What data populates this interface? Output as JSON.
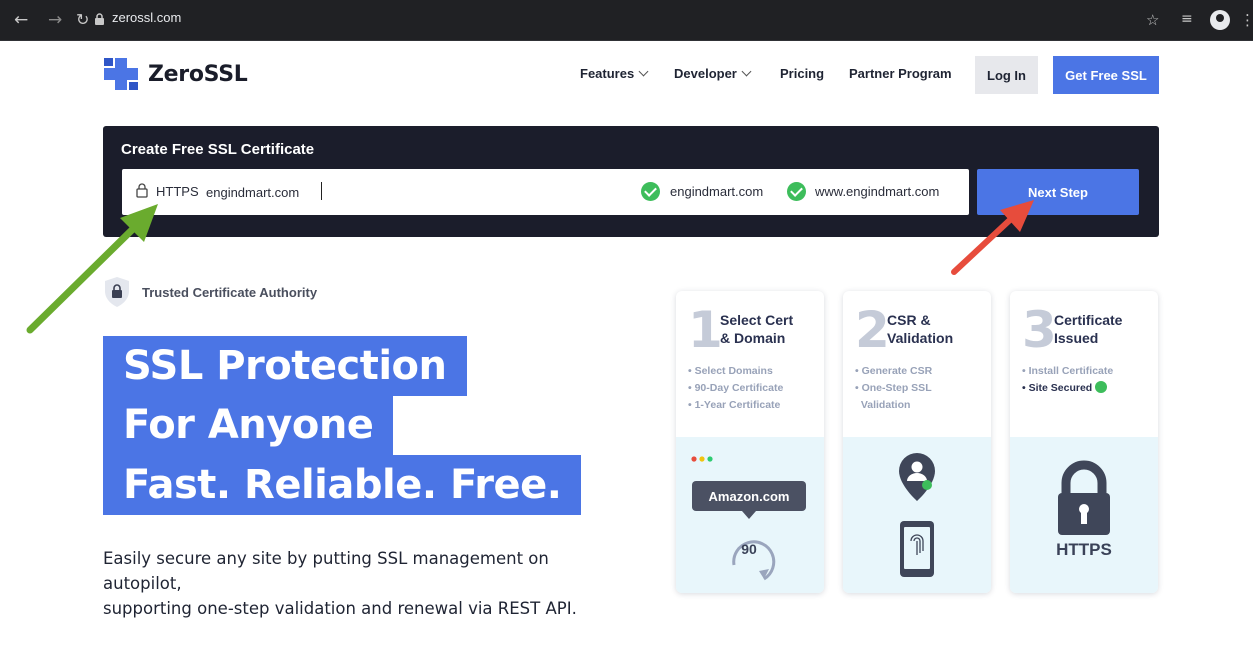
{
  "browser": {
    "url": "zerossl.com"
  },
  "header": {
    "logo_text": "ZeroSSL",
    "nav": {
      "features": "Features",
      "developer": "Developer",
      "pricing": "Pricing",
      "partner": "Partner Program"
    },
    "login_label": "Log In",
    "get_free_label": "Get Free SSL"
  },
  "create": {
    "title": "Create Free SSL Certificate",
    "protocol": "HTTPS",
    "domain_value": "engindmart.com",
    "variants": [
      "engindmart.com",
      "www.engindmart.com"
    ],
    "next_label": "Next Step"
  },
  "trusted": {
    "label": "Trusted Certificate Authority"
  },
  "hero": {
    "lines": [
      "SSL Protection",
      "For Anyone",
      "Fast. Reliable. Free."
    ],
    "description_1": "Easily secure any site by putting SSL management on autopilot,",
    "description_2": "supporting one-step validation and renewal via REST API."
  },
  "steps": [
    {
      "number": "1",
      "title_1": "Select Cert",
      "title_2": "& Domain",
      "bullets": [
        "• Select Domains",
        "• 90-Day Certificate",
        "• 1-Year Certificate"
      ],
      "illustration_label": "Amazon.com",
      "illustration_number": "90"
    },
    {
      "number": "2",
      "title_1": "CSR &",
      "title_2": "Validation",
      "bullets": [
        "• Generate CSR",
        "• One-Step SSL",
        "  Validation"
      ]
    },
    {
      "number": "3",
      "title_1": "Certificate",
      "title_2": "Issued",
      "bullets": [
        "• Install Certificate",
        "• Site Secured"
      ],
      "illustration_label": "HTTPS"
    }
  ],
  "colors": {
    "brand_blue": "#4b75e5",
    "panel_dark": "#1b1d2b",
    "check_green": "#3dbd5b",
    "annotation_green": "#6aab2e",
    "annotation_red": "#e74c3c"
  }
}
